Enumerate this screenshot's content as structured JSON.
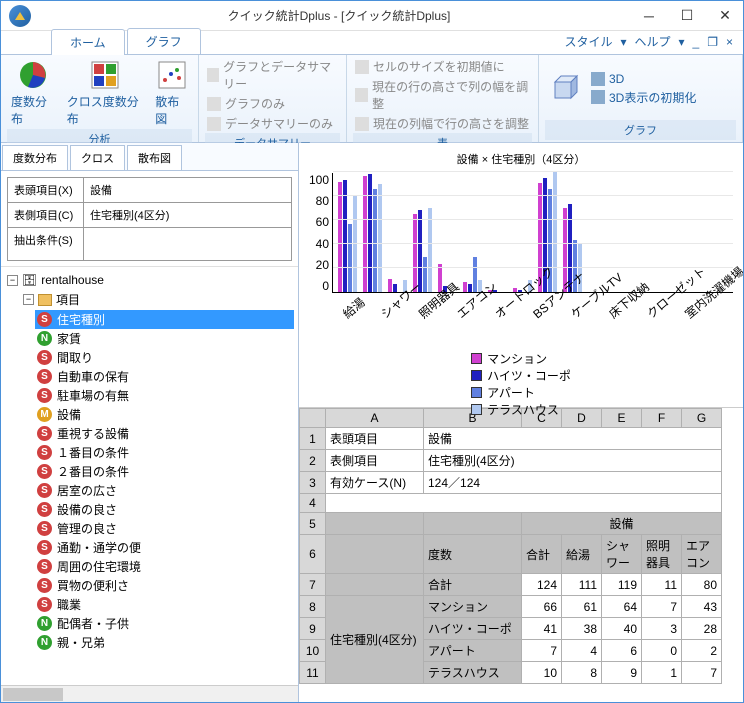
{
  "window": {
    "title": "クイック統計Dplus - [クイック統計Dplus]"
  },
  "tabs": {
    "home": "ホーム",
    "graph": "グラフ",
    "style": "スタイル",
    "help": "ヘルプ"
  },
  "ribbon": {
    "analysis": {
      "label": "分析",
      "freq": "度数分布",
      "cross": "クロス度数分布",
      "scatter": "散布図"
    },
    "summary": {
      "label": "データサマリー",
      "a": "グラフとデータサマリー",
      "b": "グラフのみ",
      "c": "データサマリーのみ"
    },
    "table": {
      "label": "表",
      "a": "セルのサイズを初期値に",
      "b": "現在の行の高さで列の幅を調整",
      "c": "現在の列幅で行の高さを調整"
    },
    "graph": {
      "label": "グラフ",
      "a": "3D",
      "b": "3D表示の初期化"
    }
  },
  "subtabs": {
    "freq": "度数分布",
    "cross": "クロス",
    "scatter": "散布図"
  },
  "form": {
    "head_label": "表頭項目(X)",
    "head_value": "設備",
    "side_label": "表側項目(C)",
    "side_value": "住宅種別(4区分)",
    "cond_label": "抽出条件(S)",
    "cond_value": ""
  },
  "tree": {
    "root": "rentalhouse",
    "folder": "項目",
    "items": [
      {
        "icon": "s",
        "label": "住宅種別",
        "sel": true
      },
      {
        "icon": "n",
        "label": "家賃"
      },
      {
        "icon": "s",
        "label": "間取り"
      },
      {
        "icon": "s",
        "label": "自動車の保有"
      },
      {
        "icon": "s",
        "label": "駐車場の有無"
      },
      {
        "icon": "m",
        "label": "設備"
      },
      {
        "icon": "s",
        "label": "重視する設備"
      },
      {
        "icon": "s",
        "label": "１番目の条件"
      },
      {
        "icon": "s",
        "label": "２番目の条件"
      },
      {
        "icon": "s",
        "label": "居室の広さ"
      },
      {
        "icon": "s",
        "label": "設備の良さ"
      },
      {
        "icon": "s",
        "label": "管理の良さ"
      },
      {
        "icon": "s",
        "label": "通勤・通学の便"
      },
      {
        "icon": "s",
        "label": "周囲の住宅環境"
      },
      {
        "icon": "s",
        "label": "買物の便利さ"
      },
      {
        "icon": "s",
        "label": "職業"
      },
      {
        "icon": "n",
        "label": "配偶者・子供"
      },
      {
        "icon": "n",
        "label": "親・兄弟"
      }
    ]
  },
  "chart_data": {
    "type": "bar",
    "title": "設備 × 住宅種別（4区分）",
    "ylim": [
      0,
      100
    ],
    "yticks": [
      0,
      20,
      40,
      60,
      80,
      100
    ],
    "categories": [
      "給湯",
      "シャワー",
      "照明器具",
      "エアコン",
      "オートロック",
      "BSアンテナ",
      "ケーブルTV",
      "床下収納",
      "クローゼット",
      "室内洗濯機場"
    ],
    "series": [
      {
        "name": "マンション",
        "color": "#d040d0",
        "values": [
          92,
          97,
          11,
          65,
          23,
          8,
          2,
          3,
          91,
          70
        ]
      },
      {
        "name": "ハイツ・コーポ",
        "color": "#2020c0",
        "values": [
          93,
          98,
          7,
          68,
          5,
          7,
          2,
          2,
          95,
          73
        ]
      },
      {
        "name": "アパート",
        "color": "#6080e0",
        "values": [
          57,
          86,
          0,
          29,
          0,
          29,
          0,
          0,
          86,
          43
        ]
      },
      {
        "name": "テラスハウス",
        "color": "#b0c8f0",
        "values": [
          80,
          90,
          10,
          70,
          0,
          10,
          0,
          10,
          100,
          40
        ]
      }
    ]
  },
  "grid": {
    "cols": [
      "A",
      "B",
      "C",
      "D",
      "E",
      "F",
      "G"
    ],
    "r1": {
      "a": "表頭項目",
      "b": "設備"
    },
    "r2": {
      "a": "表側項目",
      "b": "住宅種別(4区分)"
    },
    "r3": {
      "a": "有効ケース(N)",
      "b": "124／124"
    },
    "r5": {
      "header": "設備"
    },
    "r6": {
      "a": "度数",
      "b": "合計",
      "c": "給湯",
      "d": "シャワー",
      "e": "照明器具",
      "f": "エアコン"
    },
    "rows": [
      {
        "n": "7",
        "a": "",
        "b": "合計",
        "c": "124",
        "d": "111",
        "e": "119",
        "f": "11",
        "g": "80"
      },
      {
        "n": "8",
        "a": "住宅種別(4区分)",
        "b": "マンション",
        "c": "66",
        "d": "61",
        "e": "64",
        "f": "7",
        "g": "43"
      },
      {
        "n": "9",
        "a": "",
        "b": "ハイツ・コーポ",
        "c": "41",
        "d": "38",
        "e": "40",
        "f": "3",
        "g": "28"
      },
      {
        "n": "10",
        "a": "",
        "b": "アパート",
        "c": "7",
        "d": "4",
        "e": "6",
        "f": "0",
        "g": "2"
      },
      {
        "n": "11",
        "a": "",
        "b": "テラスハウス",
        "c": "10",
        "d": "8",
        "e": "9",
        "f": "1",
        "g": "7"
      }
    ]
  }
}
